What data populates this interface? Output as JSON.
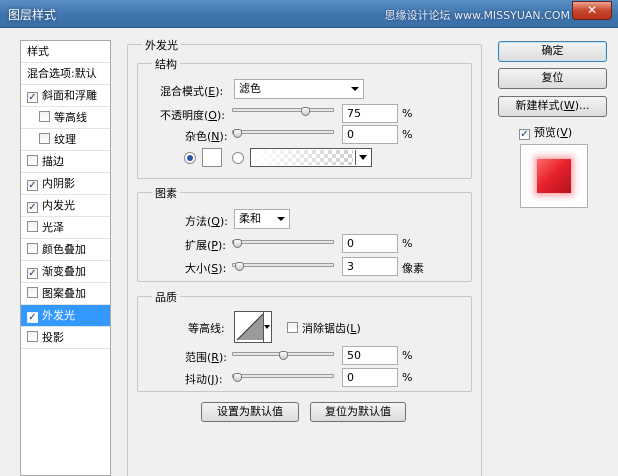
{
  "window": {
    "title": "图层样式",
    "watermark": "思缘设计论坛 www.MISSYUAN.COM",
    "close_glyph": "✕"
  },
  "style_list": {
    "header": "样式",
    "blend_options": "混合选项:默认",
    "items": [
      {
        "label": "斜面和浮雕",
        "checked": true
      },
      {
        "label": "等高线",
        "checked": false,
        "indent": true
      },
      {
        "label": "纹理",
        "checked": false,
        "indent": true
      },
      {
        "label": "描边",
        "checked": false
      },
      {
        "label": "内阴影",
        "checked": true
      },
      {
        "label": "内发光",
        "checked": true
      },
      {
        "label": "光泽",
        "checked": false
      },
      {
        "label": "颜色叠加",
        "checked": false
      },
      {
        "label": "渐变叠加",
        "checked": true
      },
      {
        "label": "图案叠加",
        "checked": false
      },
      {
        "label": "外发光",
        "checked": true,
        "selected": true
      },
      {
        "label": "投影",
        "checked": false
      }
    ]
  },
  "panel": {
    "title": "外发光",
    "structure": {
      "title": "结构",
      "blend_mode_label_pre": "混合模式(",
      "blend_mode_key": "E",
      "blend_mode_label_post": "):",
      "blend_mode_value": "滤色",
      "opacity_label_pre": "不透明度(",
      "opacity_key": "O",
      "opacity_label_post": "):",
      "opacity_value": "75",
      "opacity_unit": "%",
      "opacity_fraction": 0.75,
      "noise_label_pre": "杂色(",
      "noise_key": "N",
      "noise_label_post": "):",
      "noise_value": "0",
      "noise_unit": "%",
      "noise_fraction": 0,
      "color_radio_selected": "solid",
      "solid_color": "#ffffff"
    },
    "elements": {
      "title": "图素",
      "method_label_pre": "方法(",
      "method_key": "Q",
      "method_label_post": "):",
      "method_value": "柔和",
      "spread_label_pre": "扩展(",
      "spread_key": "P",
      "spread_label_post": "):",
      "spread_value": "0",
      "spread_unit": "%",
      "spread_fraction": 0,
      "size_label_pre": "大小(",
      "size_key": "S",
      "size_label_post": "):",
      "size_value": "3",
      "size_unit": "像素",
      "size_fraction": 0.02
    },
    "quality": {
      "title": "品质",
      "contour_label": "等高线:",
      "antialias_label_pre": "消除锯齿(",
      "antialias_key": "L",
      "antialias_label_post": ")",
      "antialias_checked": false,
      "range_label_pre": "范围(",
      "range_key": "R",
      "range_label_post": "):",
      "range_value": "50",
      "range_unit": "%",
      "range_fraction": 0.5,
      "jitter_label_pre": "抖动(",
      "jitter_key": "J",
      "jitter_label_post": "):",
      "jitter_value": "0",
      "jitter_unit": "%",
      "jitter_fraction": 0
    },
    "set_default": "设置为默认值",
    "reset_default": "复位为默认值"
  },
  "side_buttons": {
    "ok": "确定",
    "reset": "复位",
    "new_style_pre": "新建样式(",
    "new_style_key": "W",
    "new_style_post": ")...",
    "preview_pre": "预览(",
    "preview_key": "V",
    "preview_post": ")",
    "preview_checked": true
  },
  "colors": {
    "selection": "#3399ff",
    "preview_red": "#e8232e"
  }
}
